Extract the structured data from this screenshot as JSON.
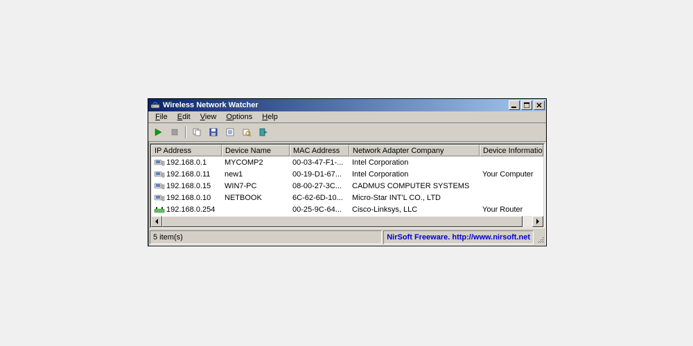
{
  "window": {
    "title": "Wireless Network Watcher"
  },
  "menu": {
    "items": [
      {
        "label": "File",
        "u": 0
      },
      {
        "label": "Edit",
        "u": 0
      },
      {
        "label": "View",
        "u": 0
      },
      {
        "label": "Options",
        "u": 0
      },
      {
        "label": "Help",
        "u": 0
      }
    ]
  },
  "columns": [
    "IP Address",
    "Device Name",
    "MAC Address",
    "Network Adapter Company",
    "Device Information"
  ],
  "rows": [
    {
      "icon": "pc",
      "ip": "192.168.0.1",
      "name": "MYCOMP2",
      "mac": "00-03-47-F1-...",
      "company": "Intel Corporation",
      "info": ""
    },
    {
      "icon": "pc",
      "ip": "192.168.0.11",
      "name": "new1",
      "mac": "00-19-D1-67...",
      "company": "Intel Corporation",
      "info": "Your Computer"
    },
    {
      "icon": "pc",
      "ip": "192.168.0.15",
      "name": "WIN7-PC",
      "mac": "08-00-27-3C...",
      "company": "CADMUS COMPUTER SYSTEMS",
      "info": ""
    },
    {
      "icon": "pc",
      "ip": "192.168.0.10",
      "name": "NETBOOK",
      "mac": "6C-62-6D-10...",
      "company": "Micro-Star INT'L CO., LTD",
      "info": ""
    },
    {
      "icon": "router",
      "ip": "192.168.0.254",
      "name": "",
      "mac": "00-25-9C-64...",
      "company": "Cisco-Linksys, LLC",
      "info": "Your Router"
    }
  ],
  "status": {
    "count": "5 item(s)",
    "credit": "NirSoft Freeware.  http://www.nirsoft.net"
  }
}
